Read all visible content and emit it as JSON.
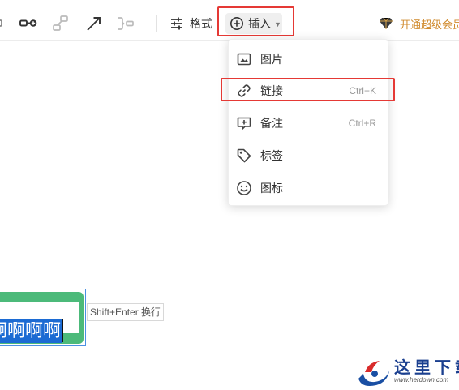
{
  "toolbar": {
    "icons": [
      "connector-icon",
      "link-node-icon",
      "group-icon",
      "arrow-line-icon",
      "bracket-icon"
    ],
    "format_label": "格式",
    "insert_label": "插入",
    "vip_label": "开通超级会员"
  },
  "insert_menu": {
    "items": [
      {
        "icon": "image-icon",
        "label": "图片",
        "shortcut": ""
      },
      {
        "icon": "link-icon",
        "label": "链接",
        "shortcut": "Ctrl+K"
      },
      {
        "icon": "note-icon",
        "label": "备注",
        "shortcut": "Ctrl+R"
      },
      {
        "icon": "tag-icon",
        "label": "标签",
        "shortcut": ""
      },
      {
        "icon": "emoji-icon",
        "label": "图标",
        "shortcut": ""
      }
    ]
  },
  "canvas": {
    "node_text": "啊啊啊啊",
    "hint": "Shift+Enter 换行"
  },
  "watermark": {
    "title": "这里下载",
    "url": "www.herdown.com"
  },
  "colors": {
    "highlight_box": "#e53935",
    "node_fill": "#4cba7a",
    "selection": "#1c6bd3",
    "vip": "#d08a2c"
  }
}
